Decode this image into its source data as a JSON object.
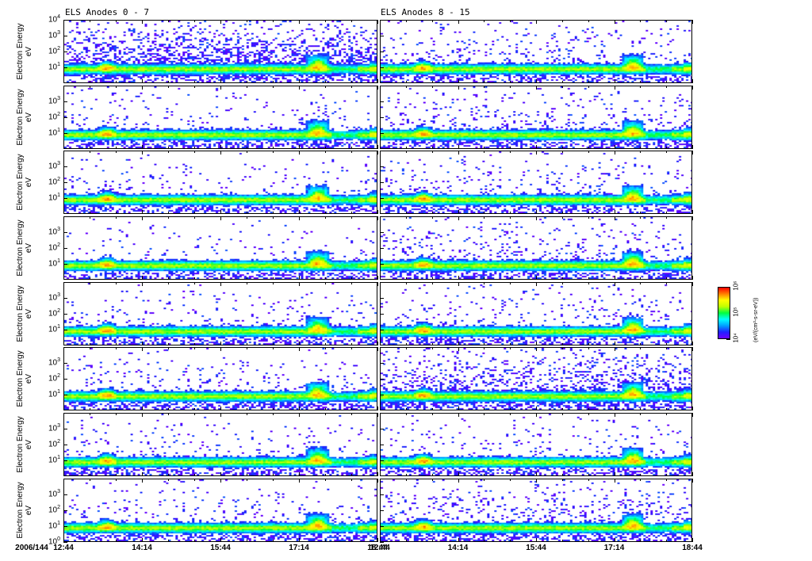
{
  "chart_data": {
    "type": "heatmap",
    "date_label": "2006/144",
    "xlabel_times": [
      "12:44",
      "14:14",
      "15:44",
      "17:14",
      "18:44"
    ],
    "x_range_minutes_from_start": [
      0,
      360
    ],
    "ylabel": "Electron Energy",
    "yunit": "eV",
    "y_log_range": [
      0,
      4
    ],
    "colorbar": {
      "label": "(eV/(cm²-s-sr-eV))",
      "tick_labels": [
        "10⁴",
        "10⁵",
        "10⁶"
      ],
      "colors": [
        "#6a00ff",
        "#2020ff",
        "#00a0ff",
        "#00ffff",
        "#00ff40",
        "#c0ff00",
        "#ffff00",
        "#ff8000",
        "#ff0000"
      ]
    },
    "columns": [
      {
        "title": "ELS Anodes 0 - 7",
        "noise": [
          0.55,
          0.1,
          0.08,
          0.06,
          0.1,
          0.1,
          0.09,
          0.1
        ]
      },
      {
        "title": "ELS Anodes 8 - 15",
        "noise": [
          0.15,
          0.16,
          0.12,
          0.15,
          0.12,
          0.38,
          0.08,
          0.22
        ]
      }
    ],
    "y_ticks_by_row": [
      [
        1,
        2,
        3,
        4
      ],
      [
        1,
        2,
        3
      ],
      [
        1,
        2,
        3
      ],
      [
        1,
        2,
        3
      ],
      [
        1,
        2,
        3
      ],
      [
        1,
        2,
        3
      ],
      [
        1,
        2,
        3
      ],
      [
        0,
        1,
        2,
        3
      ]
    ],
    "features": [
      {
        "name": "enhancement",
        "start_min": 36,
        "end_min": 60,
        "log_energy": 1.15,
        "strength": 0.35
      },
      {
        "name": "enhancement",
        "start_min": 278,
        "end_min": 304,
        "log_energy": 1.25,
        "strength": 0.45
      },
      {
        "name": "depletion",
        "start_min": 306,
        "end_min": 336,
        "log_energy": 0.9,
        "strength": -0.12
      }
    ]
  }
}
